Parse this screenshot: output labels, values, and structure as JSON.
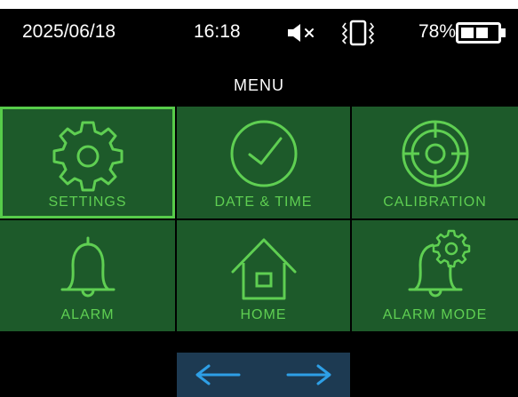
{
  "status": {
    "date": "2025/06/18",
    "time": "16:18",
    "battery_label": "78%",
    "battery_level": 0.78,
    "mute_icon": "speaker-muted-icon",
    "vibrate_icon": "vibrate-icon"
  },
  "menu": {
    "title": "MENU",
    "items": [
      {
        "label": "SETTINGS",
        "icon": "gear-icon",
        "selected": true
      },
      {
        "label": "DATE & TIME",
        "icon": "clock-icon",
        "selected": false
      },
      {
        "label": "CALIBRATION",
        "icon": "crosshair-icon",
        "selected": false
      },
      {
        "label": "ALARM",
        "icon": "bell-icon",
        "selected": false
      },
      {
        "label": "HOME",
        "icon": "house-icon",
        "selected": false
      },
      {
        "label": "ALARM MODE",
        "icon": "bell-gear-icon",
        "selected": false
      }
    ]
  },
  "nav": {
    "prev_icon": "arrow-left-icon",
    "next_icon": "arrow-right-icon"
  },
  "colors": {
    "accent_green": "#5fcf52",
    "tile_bg": "#1d5a2a",
    "nav_bg": "#1d3a52",
    "arrow_blue": "#2e9fe6"
  }
}
